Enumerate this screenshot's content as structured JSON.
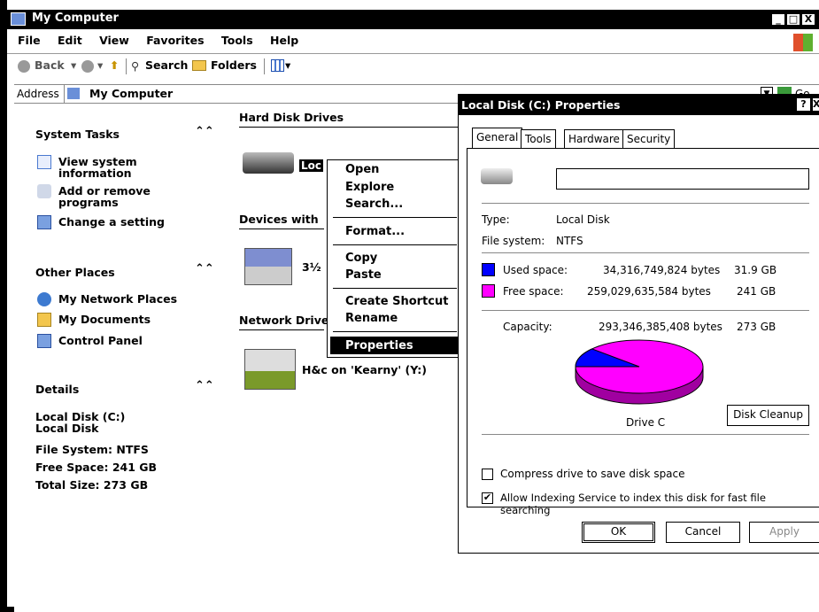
{
  "window": {
    "title": "My Computer",
    "min_label": "_",
    "max_label": "□",
    "close_label": "X"
  },
  "menu": [
    "File",
    "Edit",
    "View",
    "Favorites",
    "Tools",
    "Help"
  ],
  "toolbar": {
    "back": "Back",
    "search": "Search",
    "folders": "Folders"
  },
  "address": {
    "label": "Address",
    "value": "My Computer",
    "go": "Go"
  },
  "sidebar": {
    "system_tasks": {
      "title": "System Tasks",
      "items": [
        "View system information",
        "Add or remove programs",
        "Change a setting"
      ]
    },
    "other_places": {
      "title": "Other Places",
      "items": [
        "My Network Places",
        "My Documents",
        "Control Panel"
      ]
    },
    "details": {
      "title": "Details",
      "lines": [
        "Local Disk (C:)",
        "Local Disk",
        "File System: NTFS",
        "Free Space: 241 GB",
        "Total Size: 273 GB"
      ]
    }
  },
  "groups": {
    "hard_disk": "Hard Disk Drives",
    "devices": "Devices with",
    "network": "Network Drive"
  },
  "items": {
    "local_disk": "Loc",
    "floppy": "3½",
    "network_drive": "H&c on 'Kearny' (Y:)"
  },
  "context_menu": [
    "Open",
    "Explore",
    "Search...",
    "Format...",
    "Copy",
    "Paste",
    "Create Shortcut",
    "Rename",
    "Properties"
  ],
  "dialog": {
    "title": "Local Disk (C:) Properties",
    "help": "?",
    "close": "X",
    "tabs": [
      "General",
      "Tools",
      "Hardware",
      "Security"
    ],
    "name_value": "",
    "type_label": "Type:",
    "type_value": "Local Disk",
    "fs_label": "File system:",
    "fs_value": "NTFS",
    "used_label": "Used space:",
    "used_bytes": "34,316,749,824 bytes",
    "used_gb": "31.9 GB",
    "free_label": "Free space:",
    "free_bytes": "259,029,635,584 bytes",
    "free_gb": "241 GB",
    "cap_label": "Capacity:",
    "cap_bytes": "293,346,385,408 bytes",
    "cap_gb": "273 GB",
    "drive_label": "Drive C",
    "cleanup": "Disk Cleanup",
    "compress_label": "Compress drive to save disk space",
    "compress_checked": false,
    "index_label": "Allow Indexing Service to index this disk for fast file searching",
    "index_checked": true,
    "ok": "OK",
    "cancel": "Cancel",
    "apply": "Apply",
    "used_color": "#0000ff",
    "free_color": "#ff00ff",
    "used_fraction": 0.117
  }
}
